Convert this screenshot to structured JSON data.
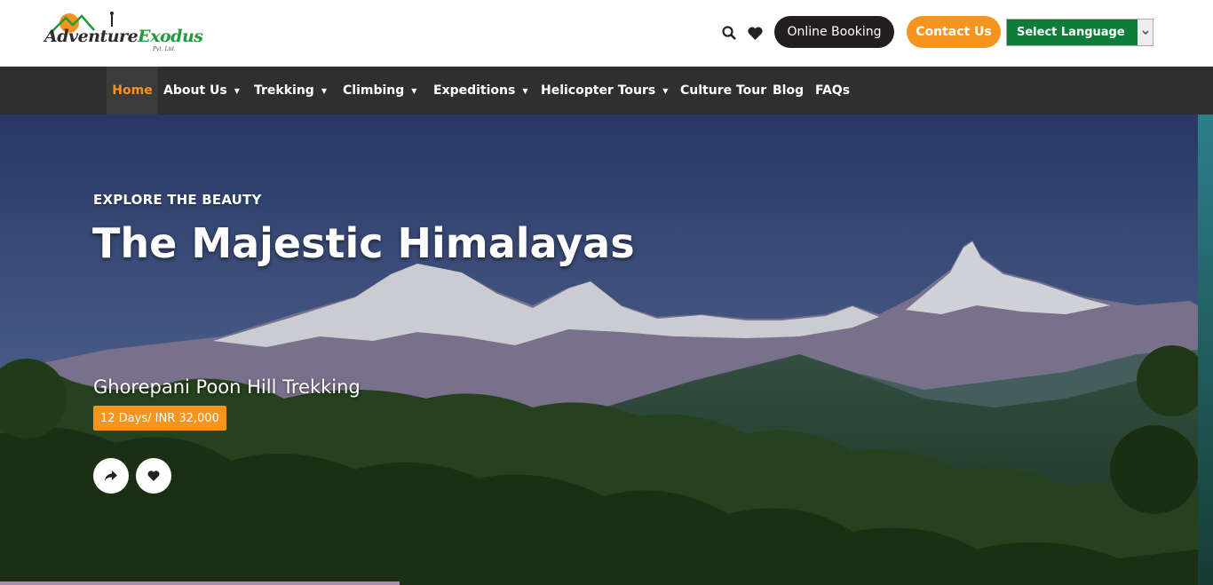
{
  "brand": {
    "name_part1": "Adventure",
    "name_part2": "Exodus",
    "suffix": "Pvt. Ltd."
  },
  "header": {
    "icons": [
      "search-icon",
      "heart-icon"
    ],
    "online_booking": "Online Booking",
    "contact_us": "Contact Us",
    "language_select": "Select Language"
  },
  "nav": {
    "items": [
      {
        "label": "Home",
        "active": true
      },
      {
        "label": "About Us",
        "dropdown": true
      },
      {
        "label": "Trekking",
        "dropdown": true
      },
      {
        "label": "Climbing",
        "dropdown": true
      },
      {
        "label": "Expeditions",
        "dropdown": true
      },
      {
        "label": "Helicopter Tours",
        "dropdown": true
      },
      {
        "label": "Culture Tour"
      },
      {
        "label": "Blog"
      },
      {
        "label": "FAQs"
      }
    ]
  },
  "hero": {
    "eyebrow": "EXPLORE THE BEAUTY",
    "headline": "The Majestic Himalayas",
    "trip_title": "Ghorepani Poon Hill Trekking",
    "price": "12 Days/ INR 32,000"
  },
  "colors": {
    "accent": "#f7941d",
    "nav_bg": "#2f2f2f",
    "booking_bg": "#231f20",
    "language_bg": "#0f7c3a"
  }
}
